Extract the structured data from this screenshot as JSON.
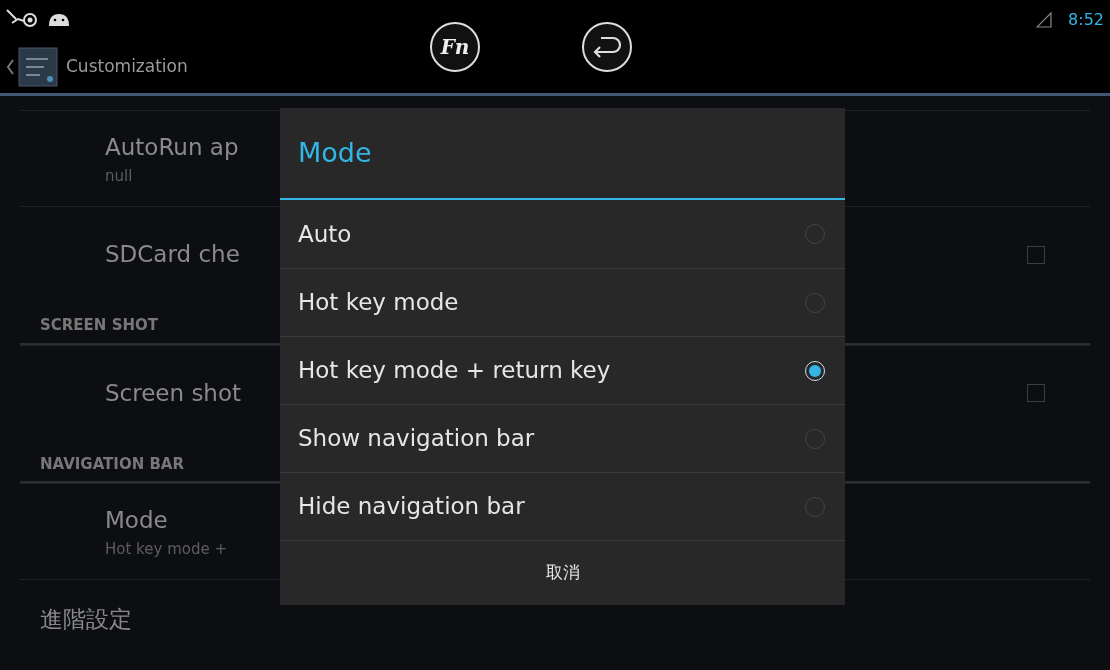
{
  "status_bar": {
    "time": "8:52"
  },
  "action_bar": {
    "title": "Customization"
  },
  "overlay_buttons": {
    "fn_label": "Fn"
  },
  "settings": [
    {
      "kind": "item",
      "title": "AutoRun ap",
      "summary": "null"
    },
    {
      "kind": "checkbox",
      "title": "SDCard che",
      "checked": false
    },
    {
      "kind": "header",
      "title": "SCREEN SHOT"
    },
    {
      "kind": "checkbox",
      "title": "Screen shot",
      "checked": false
    },
    {
      "kind": "header",
      "title": "NAVIGATION BAR"
    },
    {
      "kind": "item",
      "title": "Mode",
      "summary": "Hot key mode +"
    },
    {
      "kind": "plain",
      "title": "進階設定"
    }
  ],
  "dialog": {
    "title": "Mode",
    "options": [
      {
        "label": "Auto",
        "selected": false
      },
      {
        "label": "Hot key mode",
        "selected": false
      },
      {
        "label": "Hot key mode + return key",
        "selected": true
      },
      {
        "label": "Show navigation bar",
        "selected": false
      },
      {
        "label": "Hide navigation bar",
        "selected": false
      }
    ],
    "cancel": "取消"
  }
}
